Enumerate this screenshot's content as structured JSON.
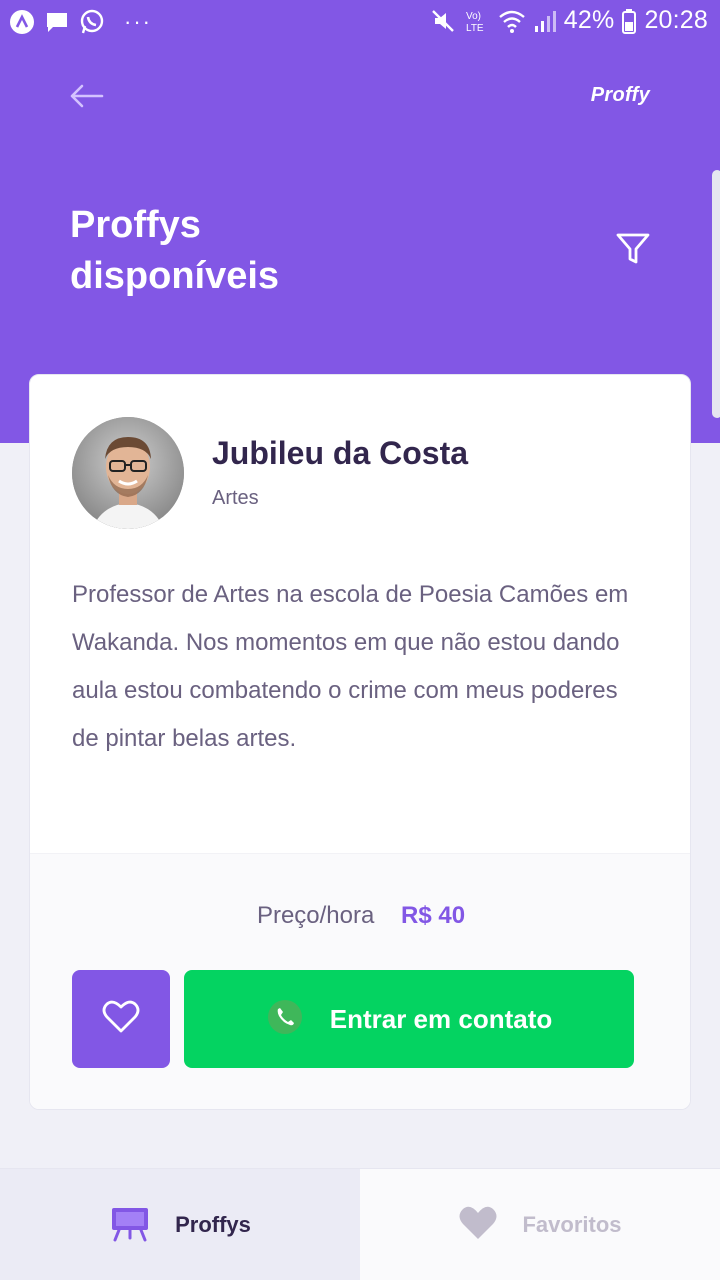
{
  "status_bar": {
    "battery": "42%",
    "time": "20:28",
    "network": "Vo) LTE",
    "more": "···"
  },
  "header": {
    "back_icon": "arrow-left-icon",
    "logo_text": "Proffy",
    "title_line1": "Proffys",
    "title_line2": "disponíveis",
    "filter_icon": "filter-icon"
  },
  "teacher_card": {
    "name": "Jubileu da Costa",
    "subject": "Artes",
    "bio": "Professor de Artes na escola de Poesia Camões em Wakanda. Nos momentos em que não estou dando aula estou combatendo o crime com meus poderes de pintar belas artes.",
    "price_label": "Preço/hora",
    "price_value": "R$ 40",
    "favorite_icon": "heart-outline-icon",
    "contact_icon": "whatsapp-icon",
    "contact_label": "Entrar em contato"
  },
  "tabs": [
    {
      "label": "Proffys",
      "icon": "easel-icon",
      "active": true
    },
    {
      "label": "Favoritos",
      "icon": "heart-icon",
      "active": false
    }
  ],
  "colors": {
    "primary": "#8257E5",
    "secondary": "#04D361",
    "background": "#F0F0F7",
    "title_text": "#32264D",
    "body_text": "#6A6180"
  }
}
